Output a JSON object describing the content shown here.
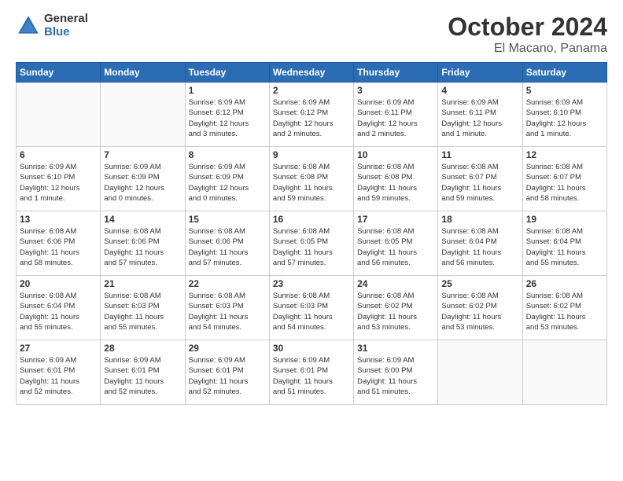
{
  "logo": {
    "general": "General",
    "blue": "Blue"
  },
  "title": {
    "month": "October 2024",
    "location": "El Macano, Panama"
  },
  "weekdays": [
    "Sunday",
    "Monday",
    "Tuesday",
    "Wednesday",
    "Thursday",
    "Friday",
    "Saturday"
  ],
  "weeks": [
    [
      {
        "day": "",
        "info": ""
      },
      {
        "day": "",
        "info": ""
      },
      {
        "day": "1",
        "info": "Sunrise: 6:09 AM\nSunset: 6:12 PM\nDaylight: 12 hours\nand 3 minutes."
      },
      {
        "day": "2",
        "info": "Sunrise: 6:09 AM\nSunset: 6:12 PM\nDaylight: 12 hours\nand 2 minutes."
      },
      {
        "day": "3",
        "info": "Sunrise: 6:09 AM\nSunset: 6:11 PM\nDaylight: 12 hours\nand 2 minutes."
      },
      {
        "day": "4",
        "info": "Sunrise: 6:09 AM\nSunset: 6:11 PM\nDaylight: 12 hours\nand 1 minute."
      },
      {
        "day": "5",
        "info": "Sunrise: 6:09 AM\nSunset: 6:10 PM\nDaylight: 12 hours\nand 1 minute."
      }
    ],
    [
      {
        "day": "6",
        "info": "Sunrise: 6:09 AM\nSunset: 6:10 PM\nDaylight: 12 hours\nand 1 minute."
      },
      {
        "day": "7",
        "info": "Sunrise: 6:09 AM\nSunset: 6:09 PM\nDaylight: 12 hours\nand 0 minutes."
      },
      {
        "day": "8",
        "info": "Sunrise: 6:09 AM\nSunset: 6:09 PM\nDaylight: 12 hours\nand 0 minutes."
      },
      {
        "day": "9",
        "info": "Sunrise: 6:08 AM\nSunset: 6:08 PM\nDaylight: 11 hours\nand 59 minutes."
      },
      {
        "day": "10",
        "info": "Sunrise: 6:08 AM\nSunset: 6:08 PM\nDaylight: 11 hours\nand 59 minutes."
      },
      {
        "day": "11",
        "info": "Sunrise: 6:08 AM\nSunset: 6:07 PM\nDaylight: 11 hours\nand 59 minutes."
      },
      {
        "day": "12",
        "info": "Sunrise: 6:08 AM\nSunset: 6:07 PM\nDaylight: 11 hours\nand 58 minutes."
      }
    ],
    [
      {
        "day": "13",
        "info": "Sunrise: 6:08 AM\nSunset: 6:06 PM\nDaylight: 11 hours\nand 58 minutes."
      },
      {
        "day": "14",
        "info": "Sunrise: 6:08 AM\nSunset: 6:06 PM\nDaylight: 11 hours\nand 57 minutes."
      },
      {
        "day": "15",
        "info": "Sunrise: 6:08 AM\nSunset: 6:06 PM\nDaylight: 11 hours\nand 57 minutes."
      },
      {
        "day": "16",
        "info": "Sunrise: 6:08 AM\nSunset: 6:05 PM\nDaylight: 11 hours\nand 57 minutes."
      },
      {
        "day": "17",
        "info": "Sunrise: 6:08 AM\nSunset: 6:05 PM\nDaylight: 11 hours\nand 56 minutes."
      },
      {
        "day": "18",
        "info": "Sunrise: 6:08 AM\nSunset: 6:04 PM\nDaylight: 11 hours\nand 56 minutes."
      },
      {
        "day": "19",
        "info": "Sunrise: 6:08 AM\nSunset: 6:04 PM\nDaylight: 11 hours\nand 55 minutes."
      }
    ],
    [
      {
        "day": "20",
        "info": "Sunrise: 6:08 AM\nSunset: 6:04 PM\nDaylight: 11 hours\nand 55 minutes."
      },
      {
        "day": "21",
        "info": "Sunrise: 6:08 AM\nSunset: 6:03 PM\nDaylight: 11 hours\nand 55 minutes."
      },
      {
        "day": "22",
        "info": "Sunrise: 6:08 AM\nSunset: 6:03 PM\nDaylight: 11 hours\nand 54 minutes."
      },
      {
        "day": "23",
        "info": "Sunrise: 6:08 AM\nSunset: 6:03 PM\nDaylight: 11 hours\nand 54 minutes."
      },
      {
        "day": "24",
        "info": "Sunrise: 6:08 AM\nSunset: 6:02 PM\nDaylight: 11 hours\nand 53 minutes."
      },
      {
        "day": "25",
        "info": "Sunrise: 6:08 AM\nSunset: 6:02 PM\nDaylight: 11 hours\nand 53 minutes."
      },
      {
        "day": "26",
        "info": "Sunrise: 6:08 AM\nSunset: 6:02 PM\nDaylight: 11 hours\nand 53 minutes."
      }
    ],
    [
      {
        "day": "27",
        "info": "Sunrise: 6:09 AM\nSunset: 6:01 PM\nDaylight: 11 hours\nand 52 minutes."
      },
      {
        "day": "28",
        "info": "Sunrise: 6:09 AM\nSunset: 6:01 PM\nDaylight: 11 hours\nand 52 minutes."
      },
      {
        "day": "29",
        "info": "Sunrise: 6:09 AM\nSunset: 6:01 PM\nDaylight: 11 hours\nand 52 minutes."
      },
      {
        "day": "30",
        "info": "Sunrise: 6:09 AM\nSunset: 6:01 PM\nDaylight: 11 hours\nand 51 minutes."
      },
      {
        "day": "31",
        "info": "Sunrise: 6:09 AM\nSunset: 6:00 PM\nDaylight: 11 hours\nand 51 minutes."
      },
      {
        "day": "",
        "info": ""
      },
      {
        "day": "",
        "info": ""
      }
    ]
  ]
}
